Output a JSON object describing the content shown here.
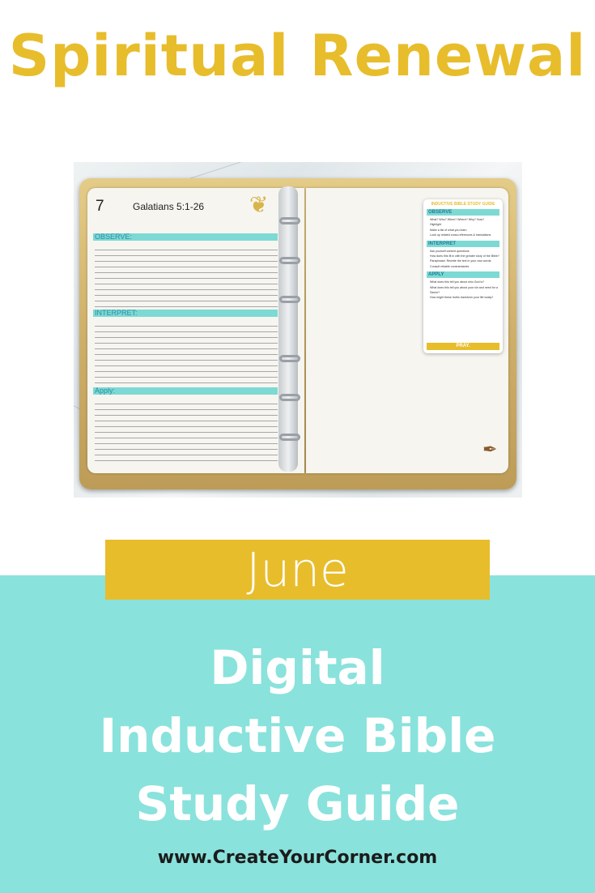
{
  "title": "Spiritual Renewal",
  "planner": {
    "day_number": "7",
    "scripture_ref": "Galatians 5:1-26",
    "sections": [
      "OBSERVE:",
      "INTERPRET:",
      "Apply:"
    ],
    "guide": {
      "title": "INDUCTIVE BIBLE STUDY GUIDE",
      "blocks": [
        {
          "heading": "OBSERVE",
          "items": [
            "What? Who? When? Where? Why? How?",
            "Highlight",
            "Make a list of what you learn",
            "Look up related cross-references & translations"
          ]
        },
        {
          "heading": "INTERPRET",
          "items": [
            "Ask yourself context questions",
            "How does this fit in with the greater story of the Bible?",
            "Paraphrase: Rewrite the text in your own words",
            "Consult reliable commentaries"
          ]
        },
        {
          "heading": "APPLY",
          "items": [
            "What does this tell you about who God is?",
            "What does this tell you about your sin and need for a Savior?",
            "How might these truths transform your life today?"
          ]
        }
      ],
      "footer": "PRAY."
    }
  },
  "month": "June",
  "subtitle_lines": [
    "Digital",
    "Inductive Bible",
    "Study Guide"
  ],
  "url": "www.CreateYourCorner.com",
  "colors": {
    "gold": "#e8bd2c",
    "teal": "#8ae2dc",
    "teal_bar": "#7dd9d3"
  }
}
